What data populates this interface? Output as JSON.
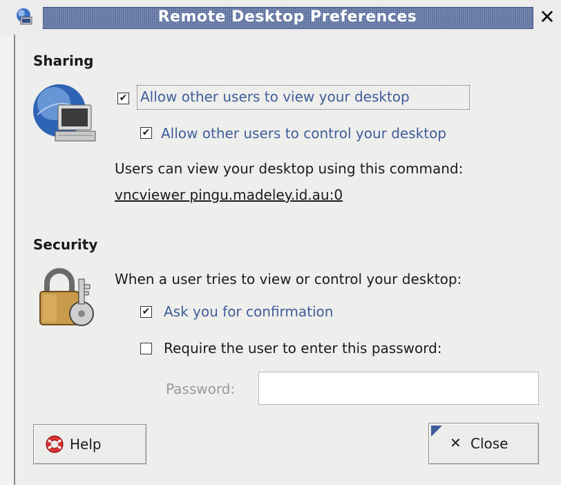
{
  "window": {
    "title": "Remote Desktop Preferences",
    "close_glyph": "✕"
  },
  "sharing": {
    "section_title": "Sharing",
    "icon": "network-computer-icon",
    "allow_view_label": "Allow other users to view your desktop",
    "allow_view_checked": true,
    "allow_control_label": "Allow other users to control your desktop",
    "allow_control_checked": true,
    "command_info": "Users can view your desktop using this command:",
    "command": "vncviewer pingu.madeley.id.au:0"
  },
  "security": {
    "section_title": "Security",
    "icon": "padlock-key-icon",
    "info": "When a user tries to view or control your desktop:",
    "ask_confirmation_label": "Ask you for confirmation",
    "ask_confirmation_checked": true,
    "require_password_label": "Require the user to enter this password:",
    "require_password_checked": false,
    "password_label": "Password:",
    "password_value": ""
  },
  "buttons": {
    "help_label": "Help",
    "close_label": "Close"
  },
  "colors": {
    "title_bar": "#5b6f9e",
    "link_text": "#3e5d9a",
    "background": "#eeeeec"
  }
}
